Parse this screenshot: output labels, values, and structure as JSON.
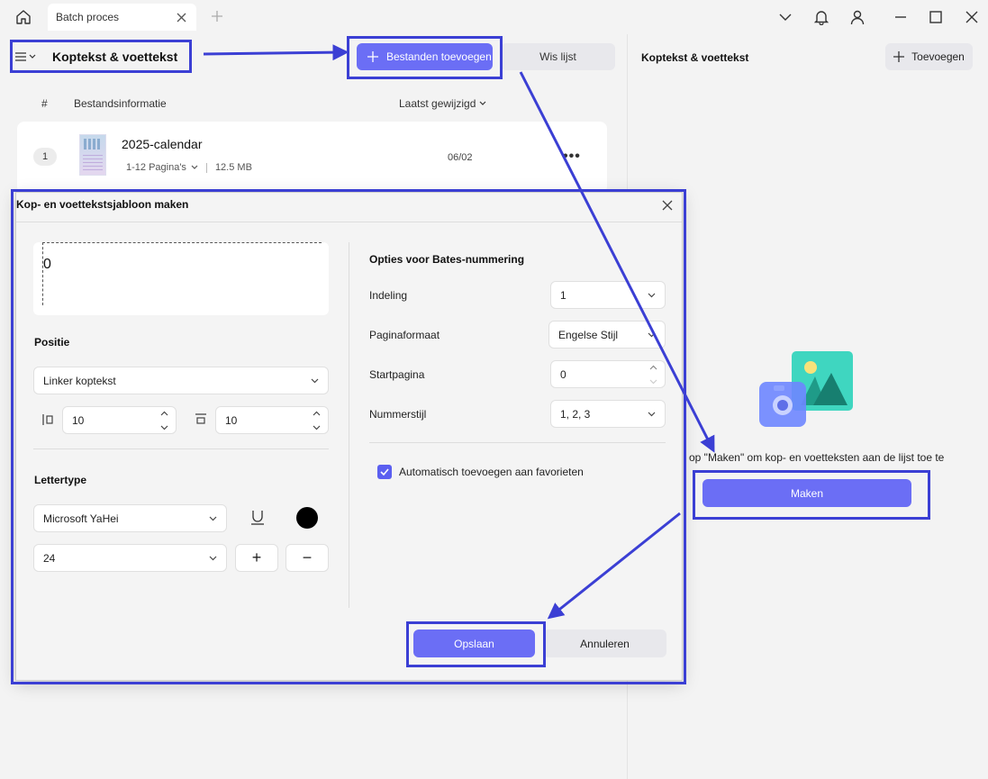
{
  "window": {
    "tab_title": "Batch proces",
    "icons": [
      "home-icon",
      "close-icon",
      "plus-icon",
      "chevron-down-icon",
      "bell-icon",
      "user-icon",
      "minimize-icon",
      "maximize-icon",
      "close-icon"
    ]
  },
  "left_panel": {
    "title": "Koptekst & voettekst",
    "add_files_label": "Bestanden toevoegen",
    "clear_list_label": "Wis lijst",
    "columns": {
      "num": "#",
      "info": "Bestandsinformatie",
      "modified": "Laatst gewijzigd"
    },
    "files": [
      {
        "num": "1",
        "name": "2025-calendar",
        "pages": "1-12 Pagina's",
        "size": "12.5 MB",
        "date": "06/02",
        "more": "•••"
      }
    ]
  },
  "right_panel": {
    "title": "Koptekst & voettekst",
    "add_label": "Toevoegen",
    "hint": "op \"Maken\" om kop- en voetteksten aan de lijst toe te",
    "make_label": "Maken"
  },
  "dialog": {
    "title": "Kop- en voettekstsjabloon maken",
    "preview_text": "0",
    "position_label": "Positie",
    "position_value": "Linker koptekst",
    "margin_left": "10",
    "margin_top": "10",
    "font_label": "Lettertype",
    "font_value": "Microsoft YaHei",
    "font_size": "24",
    "font_color": "#000000",
    "plus": "+",
    "minus": "−",
    "bates": {
      "heading": "Opties voor Bates-nummering",
      "format_label": "Indeling",
      "format_value": "1",
      "page_format_label": "Paginaformaat",
      "page_format_value": "Engelse Stijl",
      "start_label": "Startpagina",
      "start_value": "0",
      "style_label": "Nummerstijl",
      "style_value": "1, 2, 3"
    },
    "auto_add_label": "Automatisch toevoegen aan favorieten",
    "auto_add_checked": true,
    "save_label": "Opslaan",
    "cancel_label": "Annuleren"
  },
  "colors": {
    "accent": "#6b6ef5",
    "annotation": "#3b3fd4"
  }
}
